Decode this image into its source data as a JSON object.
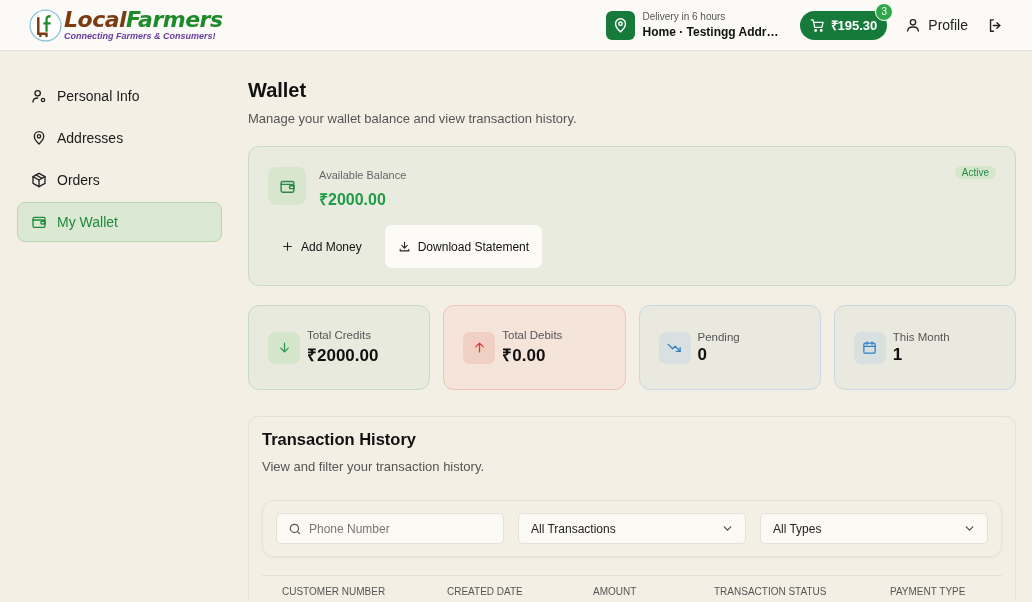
{
  "header": {
    "logo": {
      "name_parts": [
        "Local",
        "Farmers"
      ],
      "tagline": "Connecting Farmers & Consumers!"
    },
    "delivery": {
      "label": "Delivery in 6 hours",
      "address": "Home · Testingg Addr…"
    },
    "cart": {
      "total": "₹195.30",
      "count": "3"
    },
    "profile": "Profile"
  },
  "sidebar": {
    "items": [
      {
        "label": "Personal Info",
        "selected": false
      },
      {
        "label": "Addresses",
        "selected": false
      },
      {
        "label": "Orders",
        "selected": false
      },
      {
        "label": "My Wallet",
        "selected": true
      }
    ]
  },
  "page": {
    "title": "Wallet",
    "subtitle": "Manage your wallet balance and view transaction history."
  },
  "balance_card": {
    "label": "Available Balance",
    "amount": "₹2000.00",
    "status": "Active",
    "buttons": [
      {
        "label": "Add Money",
        "kind": "plain"
      },
      {
        "label": "Download Statement",
        "kind": "filled"
      }
    ]
  },
  "stats": [
    {
      "label": "Total Credits",
      "value": "₹2000.00",
      "kind": "credit"
    },
    {
      "label": "Total Debits",
      "value": "₹0.00",
      "kind": "debit"
    },
    {
      "label": "Pending",
      "value": "0",
      "kind": "pending"
    },
    {
      "label": "This Month",
      "value": "1",
      "kind": "month"
    }
  ],
  "history": {
    "title": "Transaction History",
    "subtitle": "View and filter your transaction history.",
    "search": {
      "placeholder": "Phone Number"
    },
    "selects": [
      "All Transactions",
      "All Types"
    ],
    "table": {
      "columns": [
        "CUSTOMER NUMBER",
        "CREATED DATE",
        "AMOUNT",
        "TRANSACTION STATUS",
        "PAYMENT TYPE"
      ]
    }
  }
}
